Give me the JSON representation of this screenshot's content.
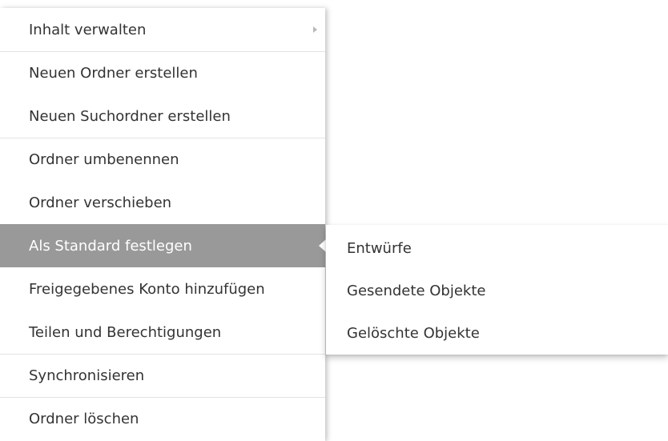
{
  "context_menu": {
    "items": [
      {
        "label": "Inhalt verwalten",
        "has_submenu": true
      },
      {
        "label": "Neuen Ordner erstellen"
      },
      {
        "label": "Neuen Suchordner erstellen"
      },
      {
        "label": "Ordner umbenennen"
      },
      {
        "label": "Ordner verschieben"
      },
      {
        "label": "Als Standard festlegen",
        "active": true,
        "has_submenu": true
      },
      {
        "label": "Freigegebenes Konto hinzufügen"
      },
      {
        "label": "Teilen und Berechtigungen"
      },
      {
        "label": "Synchronisieren"
      },
      {
        "label": "Ordner löschen"
      }
    ]
  },
  "submenu": {
    "items": [
      {
        "label": "Entwürfe"
      },
      {
        "label": "Gesendete Objekte"
      },
      {
        "label": "Gelöschte Objekte"
      }
    ]
  },
  "colors": {
    "active_bg": "#999999",
    "active_text": "#ffffff",
    "text": "#333333",
    "separator": "#e3e3e3",
    "chevron": "#b8b8b8"
  },
  "icons": {
    "submenu_indicator": "chevron-right-icon",
    "active_pointer": "caret-left-icon"
  }
}
